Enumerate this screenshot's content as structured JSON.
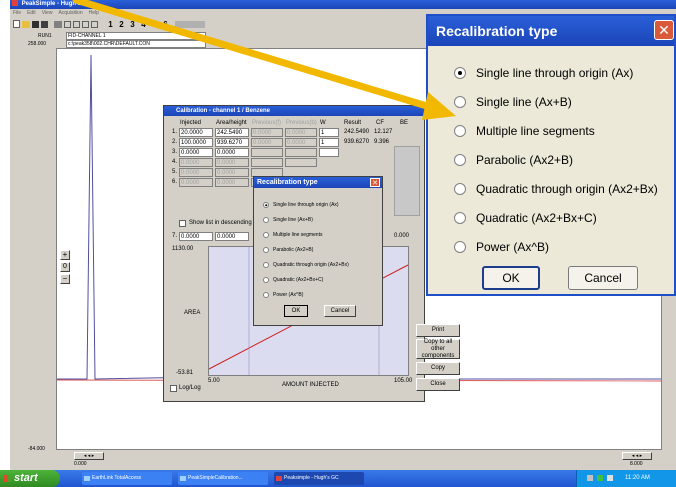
{
  "main_window": {
    "title": "PeakSimple - Hugh's GC",
    "menu": [
      "File",
      "Edit",
      "View",
      "Acquisition",
      "Help"
    ],
    "toolbar_numbers": [
      "1",
      "2",
      "3",
      "4",
      "5",
      "6"
    ],
    "run_label": "RUN1",
    "channel_label": "FID-CHANNEL 1",
    "path": "c:\\peak358\\002.CHR\\DEFAULT.CON",
    "y_top": "258.000",
    "y_bottom": "-84.000",
    "x_left": "0.000",
    "x_right": "8.000"
  },
  "calibration": {
    "title": "Calibration - channel 1 / Benzene",
    "columns": [
      "Injected",
      "Area/height",
      "Previous(f)",
      "Previous(b)",
      "W",
      "Result",
      "CF",
      "BE"
    ],
    "rows": [
      {
        "n": "1.",
        "injected": "20.0000",
        "area": "242.5490",
        "prev1": "0.0000",
        "prev2": "0.0000",
        "w": "1",
        "result": "242.5490",
        "cf": "12.127"
      },
      {
        "n": "2.",
        "injected": "100.0000",
        "area": "939.6270",
        "prev1": "0.0000",
        "prev2": "0.0000",
        "w": "1",
        "result": "939.6270",
        "cf": "9.396"
      },
      {
        "n": "3.",
        "injected": "0.0000",
        "area": "0.0000",
        "prev1": "",
        "prev2": "",
        "w": "",
        "result": "",
        "cf": ""
      },
      {
        "n": "4.",
        "injected": "0.0000",
        "area": "0.0000",
        "prev1": "",
        "prev2": "",
        "w": "",
        "result": "",
        "cf": ""
      },
      {
        "n": "5.",
        "injected": "0.0000",
        "area": "0.0000",
        "prev1": "",
        "prev2": "",
        "w": "",
        "result": "",
        "cf": ""
      },
      {
        "n": "6.",
        "injected": "0.0000",
        "area": "0.0000",
        "prev1": "",
        "prev2": "",
        "w": "",
        "result": "",
        "cf": ""
      }
    ],
    "show_list_label": "Show list in descending",
    "row7": {
      "n": "7.",
      "injected": "0.0000",
      "area": "0.0000",
      "result": "0.000"
    },
    "plot_ymax": "1130.00",
    "plot_ymin": "-53.81",
    "plot_xmin": "5.00",
    "plot_xmax": "105.00",
    "ylabel": "AREA",
    "xlabel": "AMOUNT INJECTED",
    "loglog_label": "Log/Log",
    "buttons": [
      "Print",
      "Copy to all other components",
      "Copy",
      "Close"
    ]
  },
  "recal_small": {
    "title": "Recalibration type",
    "options": [
      "Single line through origin (Ax)",
      "Single line (Ax+B)",
      "Multiple line segments",
      "Parabolic (Ax2+B)",
      "Quadratic through origin (Ax2+Bx)",
      "Quadratic (Ax2+Bx+C)",
      "Power (Ax^B)"
    ],
    "ok": "OK",
    "cancel": "Cancel"
  },
  "recal_big": {
    "title": "Recalibration type",
    "options": [
      "Single line through origin (Ax)",
      "Single line (Ax+B)",
      "Multiple line segments",
      "Parabolic (Ax2+B)",
      "Quadratic through origin (Ax2+Bx)",
      "Quadratic (Ax2+Bx+C)",
      "Power (Ax^B)"
    ],
    "selected_index": 0,
    "ok": "OK",
    "cancel": "Cancel"
  },
  "taskbar": {
    "start": "start",
    "items": [
      "EarthLink TotalAccess",
      "PeakSimpleCalibration...",
      "Peaksimple - Hugh's GC"
    ],
    "clock": "11:20 AM"
  },
  "colors": {
    "title_blue": "#1e4fc8",
    "plot_panel": "#dcdcf0",
    "arrow": "#f2b800",
    "taskbar": "#245edb",
    "start_green": "#3a9a2a",
    "close_red": "#d85a3a"
  }
}
